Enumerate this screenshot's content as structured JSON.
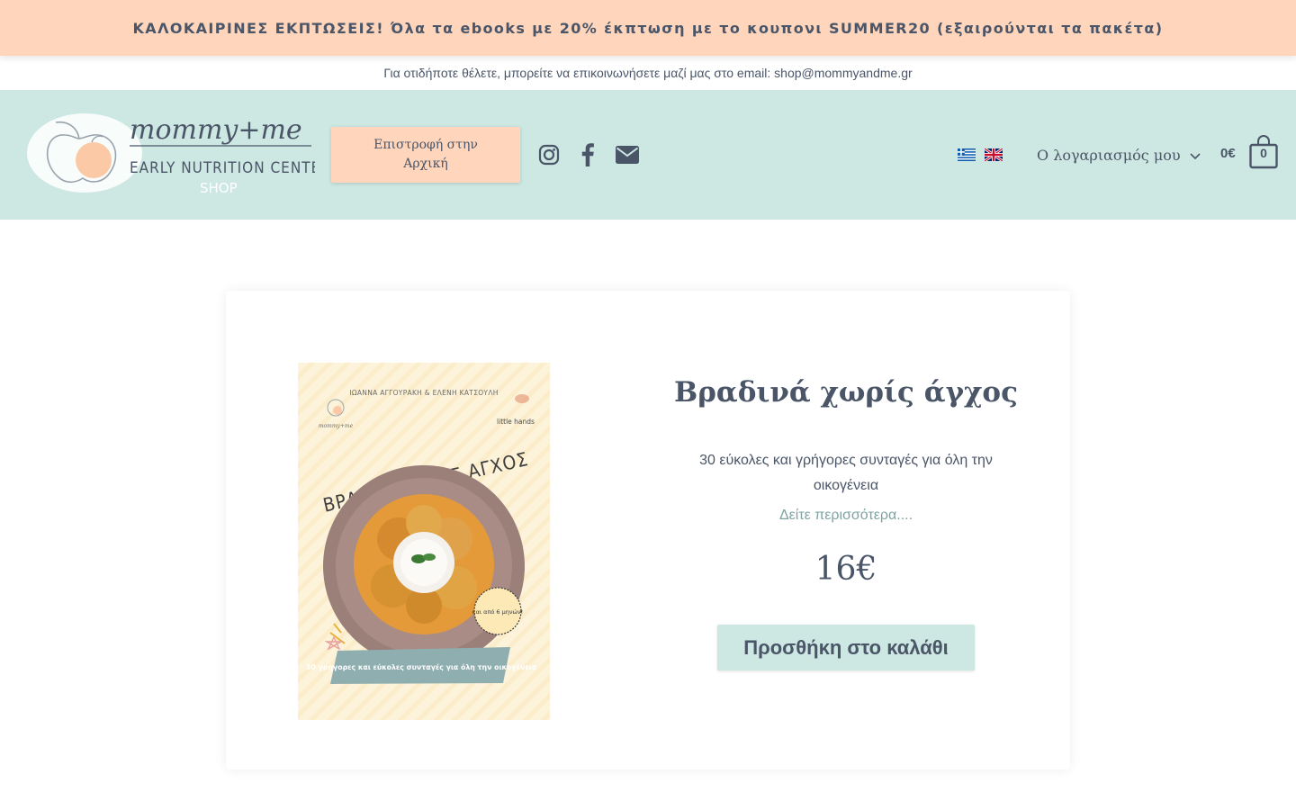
{
  "promo": {
    "text": "ΚΑΛΟΚΑΙΡΙΝΕΣ ΕΚΠΤΩΣΕΙΣ! Όλα τα ebooks με 20% έκπτωση με το κουπονι SUMMER20 (εξαιρούνται τα πακέτα)"
  },
  "contact": {
    "text": "Για οτιδήποτε θέλετε, μπορείτε να επικοινωνήσετε μαζί μας στο email: shop@mommyandme.gr"
  },
  "header": {
    "logo": {
      "wordmark": "mommy+me",
      "tagline": "EARLY NUTRITION CENTER",
      "shop": "SHOP"
    },
    "home_button": "Επιστροφή στην Αρχική",
    "social": [
      "instagram-icon",
      "facebook-icon",
      "envelope-icon"
    ],
    "languages": [
      "Greek",
      "English"
    ],
    "account_label": "Ο λογαριασμός μου",
    "cart_total": "0€",
    "cart_count": "0"
  },
  "product": {
    "cover": {
      "authors": "ΙΩΑΝΝΑ ΑΓΓΟΥΡΑΚΗ & ΕΛΕΝΗ ΚΑΤΣΟΥΛΗ",
      "left_logo": "mommy+me",
      "right_logo": "little hands",
      "title": "ΒΡΑΔΙΝΑ ΧΩΡΙΣ ΑΓΧΟΣ",
      "badge": "και από 6 μηνών!",
      "banner": "30 γρήγορες και εύκολες συνταγές για όλη την οικογένεια"
    },
    "title": "Βραδινά χωρίς άγχος",
    "subtitle": "30 εύκολες και γρήγορες συνταγές για όλη την οικογένεια",
    "see_more": "Δείτε περισσότερα....",
    "price": "16€",
    "add_to_cart": "Προσθήκη στο καλάθι"
  },
  "colors": {
    "peach": "#ffd5bb",
    "mint": "#cde7e2",
    "text": "#4a5568",
    "link": "#7fa3a0"
  }
}
